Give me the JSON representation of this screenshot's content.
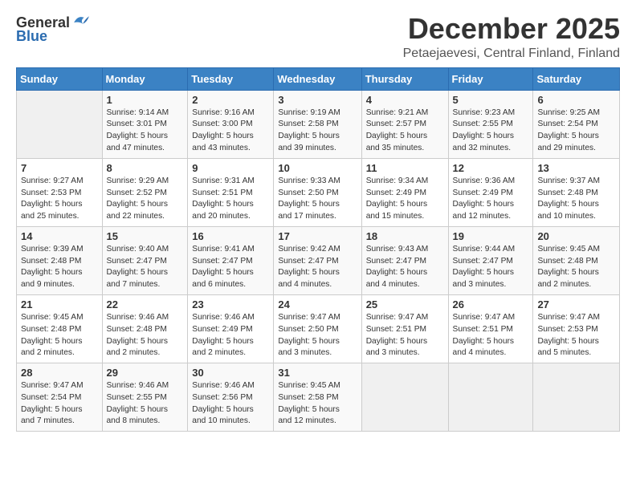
{
  "logo": {
    "general": "General",
    "blue": "Blue"
  },
  "title": "December 2025",
  "subtitle": "Petaejaevesi, Central Finland, Finland",
  "header_days": [
    "Sunday",
    "Monday",
    "Tuesday",
    "Wednesday",
    "Thursday",
    "Friday",
    "Saturday"
  ],
  "weeks": [
    [
      {
        "day": "",
        "info": ""
      },
      {
        "day": "1",
        "info": "Sunrise: 9:14 AM\nSunset: 3:01 PM\nDaylight: 5 hours\nand 47 minutes."
      },
      {
        "day": "2",
        "info": "Sunrise: 9:16 AM\nSunset: 3:00 PM\nDaylight: 5 hours\nand 43 minutes."
      },
      {
        "day": "3",
        "info": "Sunrise: 9:19 AM\nSunset: 2:58 PM\nDaylight: 5 hours\nand 39 minutes."
      },
      {
        "day": "4",
        "info": "Sunrise: 9:21 AM\nSunset: 2:57 PM\nDaylight: 5 hours\nand 35 minutes."
      },
      {
        "day": "5",
        "info": "Sunrise: 9:23 AM\nSunset: 2:55 PM\nDaylight: 5 hours\nand 32 minutes."
      },
      {
        "day": "6",
        "info": "Sunrise: 9:25 AM\nSunset: 2:54 PM\nDaylight: 5 hours\nand 29 minutes."
      }
    ],
    [
      {
        "day": "7",
        "info": "Sunrise: 9:27 AM\nSunset: 2:53 PM\nDaylight: 5 hours\nand 25 minutes."
      },
      {
        "day": "8",
        "info": "Sunrise: 9:29 AM\nSunset: 2:52 PM\nDaylight: 5 hours\nand 22 minutes."
      },
      {
        "day": "9",
        "info": "Sunrise: 9:31 AM\nSunset: 2:51 PM\nDaylight: 5 hours\nand 20 minutes."
      },
      {
        "day": "10",
        "info": "Sunrise: 9:33 AM\nSunset: 2:50 PM\nDaylight: 5 hours\nand 17 minutes."
      },
      {
        "day": "11",
        "info": "Sunrise: 9:34 AM\nSunset: 2:49 PM\nDaylight: 5 hours\nand 15 minutes."
      },
      {
        "day": "12",
        "info": "Sunrise: 9:36 AM\nSunset: 2:49 PM\nDaylight: 5 hours\nand 12 minutes."
      },
      {
        "day": "13",
        "info": "Sunrise: 9:37 AM\nSunset: 2:48 PM\nDaylight: 5 hours\nand 10 minutes."
      }
    ],
    [
      {
        "day": "14",
        "info": "Sunrise: 9:39 AM\nSunset: 2:48 PM\nDaylight: 5 hours\nand 9 minutes."
      },
      {
        "day": "15",
        "info": "Sunrise: 9:40 AM\nSunset: 2:47 PM\nDaylight: 5 hours\nand 7 minutes."
      },
      {
        "day": "16",
        "info": "Sunrise: 9:41 AM\nSunset: 2:47 PM\nDaylight: 5 hours\nand 6 minutes."
      },
      {
        "day": "17",
        "info": "Sunrise: 9:42 AM\nSunset: 2:47 PM\nDaylight: 5 hours\nand 4 minutes."
      },
      {
        "day": "18",
        "info": "Sunrise: 9:43 AM\nSunset: 2:47 PM\nDaylight: 5 hours\nand 4 minutes."
      },
      {
        "day": "19",
        "info": "Sunrise: 9:44 AM\nSunset: 2:47 PM\nDaylight: 5 hours\nand 3 minutes."
      },
      {
        "day": "20",
        "info": "Sunrise: 9:45 AM\nSunset: 2:48 PM\nDaylight: 5 hours\nand 2 minutes."
      }
    ],
    [
      {
        "day": "21",
        "info": "Sunrise: 9:45 AM\nSunset: 2:48 PM\nDaylight: 5 hours\nand 2 minutes."
      },
      {
        "day": "22",
        "info": "Sunrise: 9:46 AM\nSunset: 2:48 PM\nDaylight: 5 hours\nand 2 minutes."
      },
      {
        "day": "23",
        "info": "Sunrise: 9:46 AM\nSunset: 2:49 PM\nDaylight: 5 hours\nand 2 minutes."
      },
      {
        "day": "24",
        "info": "Sunrise: 9:47 AM\nSunset: 2:50 PM\nDaylight: 5 hours\nand 3 minutes."
      },
      {
        "day": "25",
        "info": "Sunrise: 9:47 AM\nSunset: 2:51 PM\nDaylight: 5 hours\nand 3 minutes."
      },
      {
        "day": "26",
        "info": "Sunrise: 9:47 AM\nSunset: 2:51 PM\nDaylight: 5 hours\nand 4 minutes."
      },
      {
        "day": "27",
        "info": "Sunrise: 9:47 AM\nSunset: 2:53 PM\nDaylight: 5 hours\nand 5 minutes."
      }
    ],
    [
      {
        "day": "28",
        "info": "Sunrise: 9:47 AM\nSunset: 2:54 PM\nDaylight: 5 hours\nand 7 minutes."
      },
      {
        "day": "29",
        "info": "Sunrise: 9:46 AM\nSunset: 2:55 PM\nDaylight: 5 hours\nand 8 minutes."
      },
      {
        "day": "30",
        "info": "Sunrise: 9:46 AM\nSunset: 2:56 PM\nDaylight: 5 hours\nand 10 minutes."
      },
      {
        "day": "31",
        "info": "Sunrise: 9:45 AM\nSunset: 2:58 PM\nDaylight: 5 hours\nand 12 minutes."
      },
      {
        "day": "",
        "info": ""
      },
      {
        "day": "",
        "info": ""
      },
      {
        "day": "",
        "info": ""
      }
    ]
  ]
}
